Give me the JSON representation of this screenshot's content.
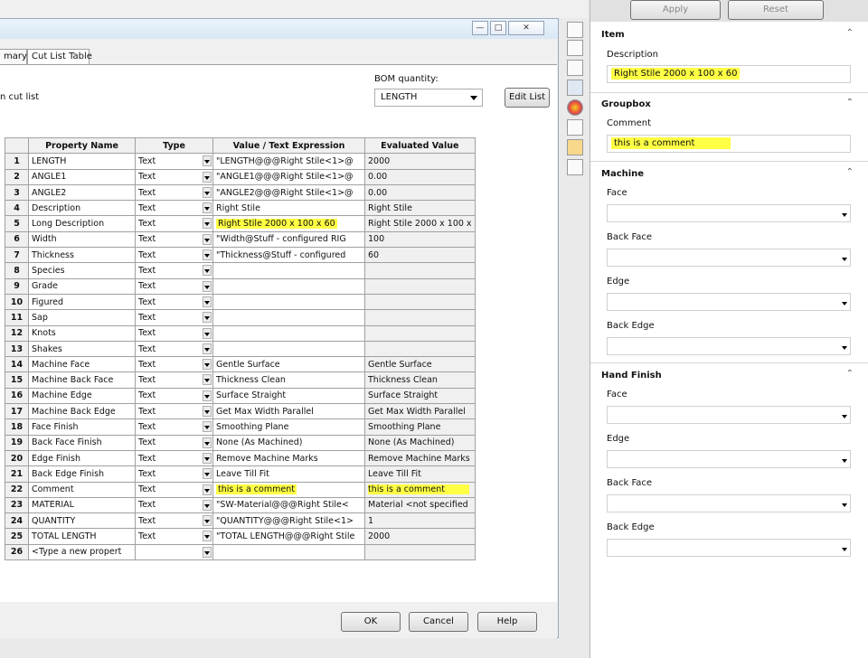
{
  "dialog": {
    "tabs": [
      "mary",
      "Cut List Table"
    ],
    "cut_list_label": "n cut list",
    "bom_quantity_label": "BOM quantity:",
    "bom_quantity_value": "LENGTH",
    "edit_list_label": "Edit List",
    "ok_label": "OK",
    "cancel_label": "Cancel",
    "help_label": "Help",
    "table": {
      "headers": [
        "Property Name",
        "Type",
        "Value / Text Expression",
        "Evaluated Value"
      ],
      "rows": [
        {
          "n": "1",
          "name": "LENGTH",
          "type": "Text",
          "value": "\"LENGTH@@@Right Stile<1>@",
          "eval": "2000"
        },
        {
          "n": "2",
          "name": "ANGLE1",
          "type": "Text",
          "value": "\"ANGLE1@@@Right Stile<1>@",
          "eval": "0.00"
        },
        {
          "n": "3",
          "name": "ANGLE2",
          "type": "Text",
          "value": "\"ANGLE2@@@Right Stile<1>@",
          "eval": "0.00"
        },
        {
          "n": "4",
          "name": "Description",
          "type": "Text",
          "value": "Right Stile",
          "eval": "Right Stile"
        },
        {
          "n": "5",
          "name": "Long Description",
          "type": "Text",
          "value": "Right Stile 2000 x 100 x 60",
          "eval": "Right Stile 2000 x 100 x",
          "hl_value": true
        },
        {
          "n": "6",
          "name": "Width",
          "type": "Text",
          "value": "\"Width@Stuff - configured RIG",
          "eval": "100"
        },
        {
          "n": "7",
          "name": "Thickness",
          "type": "Text",
          "value": "\"Thickness@Stuff - configured",
          "eval": "60"
        },
        {
          "n": "8",
          "name": "Species",
          "type": "Text",
          "value": "",
          "eval": ""
        },
        {
          "n": "9",
          "name": "Grade",
          "type": "Text",
          "value": "",
          "eval": ""
        },
        {
          "n": "10",
          "name": "Figured",
          "type": "Text",
          "value": "",
          "eval": ""
        },
        {
          "n": "11",
          "name": "Sap",
          "type": "Text",
          "value": "",
          "eval": ""
        },
        {
          "n": "12",
          "name": "Knots",
          "type": "Text",
          "value": "",
          "eval": ""
        },
        {
          "n": "13",
          "name": "Shakes",
          "type": "Text",
          "value": "",
          "eval": ""
        },
        {
          "n": "14",
          "name": "Machine Face",
          "type": "Text",
          "value": "Gentle Surface",
          "eval": "Gentle Surface"
        },
        {
          "n": "15",
          "name": "Machine Back Face",
          "type": "Text",
          "value": "Thickness Clean",
          "eval": "Thickness Clean"
        },
        {
          "n": "16",
          "name": "Machine Edge",
          "type": "Text",
          "value": "Surface Straight",
          "eval": "Surface Straight"
        },
        {
          "n": "17",
          "name": "Machine Back Edge",
          "type": "Text",
          "value": "Get Max Width Parallel",
          "eval": "Get Max Width Parallel"
        },
        {
          "n": "18",
          "name": "Face Finish",
          "type": "Text",
          "value": "Smoothing Plane",
          "eval": "Smoothing Plane"
        },
        {
          "n": "19",
          "name": "Back Face Finish",
          "type": "Text",
          "value": "None (As Machined)",
          "eval": "None (As Machined)"
        },
        {
          "n": "20",
          "name": "Edge Finish",
          "type": "Text",
          "value": "Remove Machine Marks",
          "eval": "Remove Machine Marks"
        },
        {
          "n": "21",
          "name": "Back Edge Finish",
          "type": "Text",
          "value": "Leave Till Fit",
          "eval": "Leave Till Fit"
        },
        {
          "n": "22",
          "name": "Comment",
          "type": "Text",
          "value": "this is a comment",
          "eval": "this is a comment",
          "hl_value": true,
          "hl_eval": true
        },
        {
          "n": "23",
          "name": "MATERIAL",
          "type": "Text",
          "value": "\"SW-Material@@@Right Stile<",
          "eval": "Material <not specified"
        },
        {
          "n": "24",
          "name": "QUANTITY",
          "type": "Text",
          "value": "\"QUANTITY@@@Right Stile<1>",
          "eval": "1"
        },
        {
          "n": "25",
          "name": "TOTAL LENGTH",
          "type": "Text",
          "value": "\"TOTAL LENGTH@@@Right Stile",
          "eval": "2000"
        },
        {
          "n": "26",
          "name": "<Type a new propert",
          "type": "",
          "value": "",
          "eval": ""
        }
      ]
    }
  },
  "panel": {
    "apply_label": "Apply",
    "reset_label": "Reset",
    "item": {
      "title": "Item",
      "description_label": "Description",
      "description_value": "Right Stile 2000 x 100 x 60"
    },
    "groupbox": {
      "title": "Groupbox",
      "comment_label": "Comment",
      "comment_value": "this is a comment"
    },
    "machine": {
      "title": "Machine",
      "fields": [
        "Face",
        "Back Face",
        "Edge",
        "Back Edge"
      ]
    },
    "hand_finish": {
      "title": "Hand Finish",
      "fields": [
        "Face",
        "Edge",
        "Back Face",
        "Back Edge"
      ]
    },
    "highlight_color": "#ffff44"
  },
  "icons": [
    "home-icon",
    "parts-icon",
    "folder-icon",
    "display-icon",
    "appearance-icon",
    "properties-icon",
    "custom-props-icon",
    "forum-icon"
  ]
}
